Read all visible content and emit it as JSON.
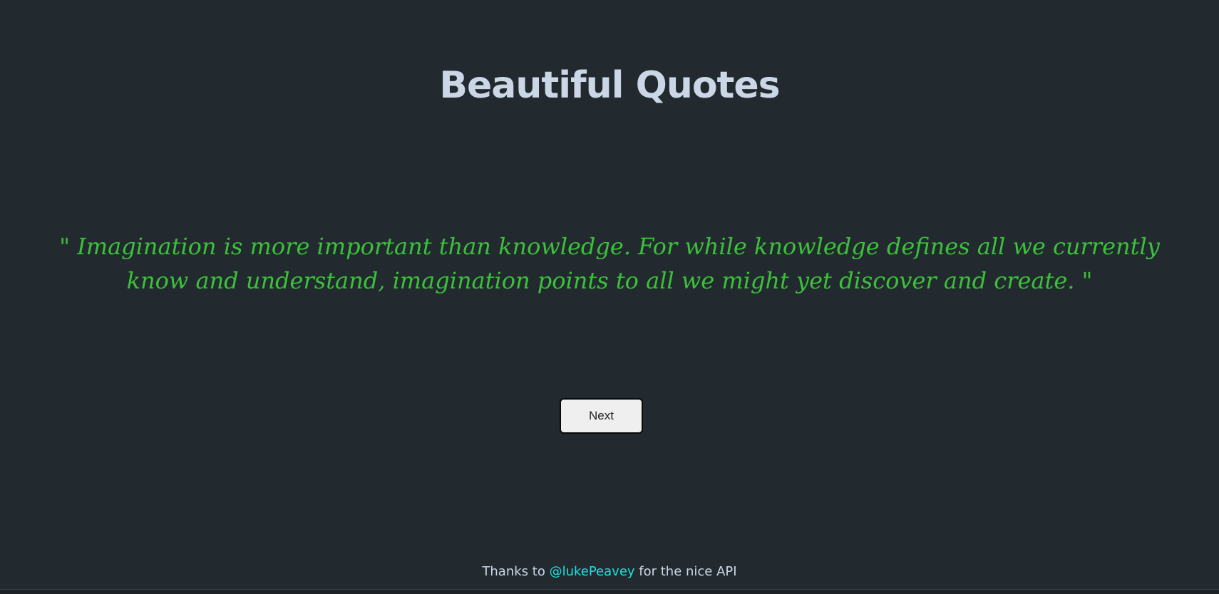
{
  "header": {
    "title": "Beautiful Quotes"
  },
  "quote": {
    "text": "\" Imagination is more important than knowledge. For while knowledge defines all we currently know and understand, imagination points to all we might yet discover and create. \""
  },
  "controls": {
    "next_label": "Next"
  },
  "footer": {
    "prefix": "Thanks to ",
    "link_text": "@lukePeavey",
    "suffix": " for the nice API"
  },
  "colors": {
    "background": "#232a2f",
    "title": "#cbd6e6",
    "quote": "#3bc13a",
    "link": "#1ee0dd"
  }
}
